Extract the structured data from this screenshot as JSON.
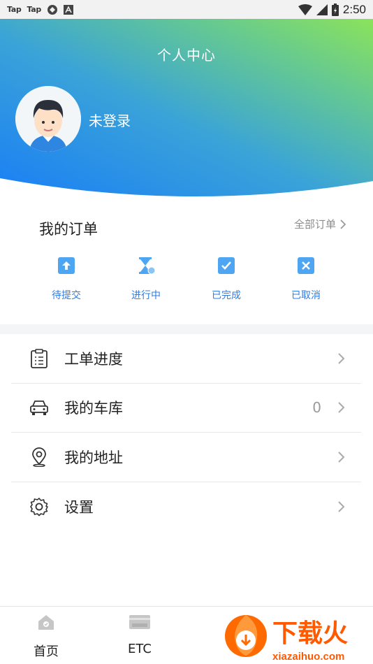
{
  "status_bar": {
    "apps": [
      "Tap",
      "Tap"
    ],
    "time": "2:50"
  },
  "header": {
    "title": "个人中心",
    "login_text": "未登录",
    "gradient_colors": [
      "#1a7ff5",
      "#8be35a"
    ]
  },
  "orders": {
    "title": "我的订单",
    "all_label": "全部订单",
    "items": [
      {
        "label": "待提交",
        "icon": "upload-icon"
      },
      {
        "label": "进行中",
        "icon": "hourglass-icon"
      },
      {
        "label": "已完成",
        "icon": "check-icon"
      },
      {
        "label": "已取消",
        "icon": "cancel-icon"
      }
    ],
    "accent": "#2f7de1"
  },
  "menu": {
    "items": [
      {
        "label": "工单进度",
        "icon": "clipboard-icon",
        "value": ""
      },
      {
        "label": "我的车库",
        "icon": "car-icon",
        "value": "0"
      },
      {
        "label": "我的地址",
        "icon": "location-pin-icon",
        "value": ""
      },
      {
        "label": "设置",
        "icon": "gear-icon",
        "value": ""
      }
    ]
  },
  "tabbar": {
    "items": [
      {
        "label": "首页",
        "icon": "home-icon"
      },
      {
        "label": "ETC",
        "icon": "etc-card-icon"
      }
    ]
  },
  "watermark": {
    "brand": "下载火",
    "url": "xiazaihuo.com"
  }
}
